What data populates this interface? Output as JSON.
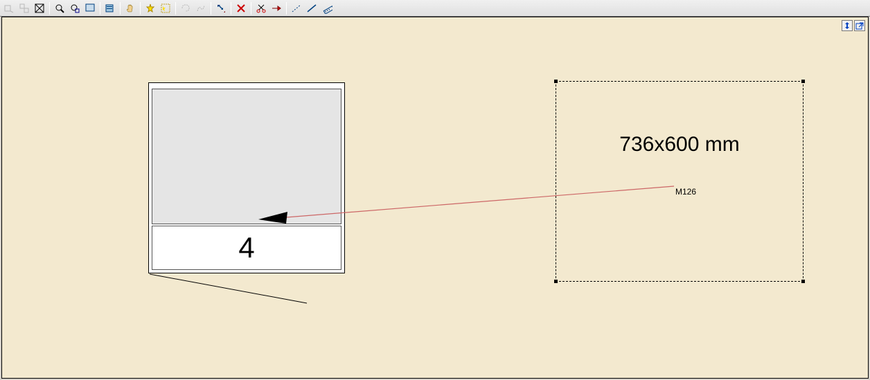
{
  "toolbar": {
    "groups": [
      [
        "zoom-window-icon",
        "zoom-out-icon",
        "zoom-fit-icon"
      ],
      [
        "zoom-in-tool-icon",
        "zoom-extents-icon",
        "zoom-selected-icon"
      ],
      [
        "properties-icon"
      ],
      [
        "pan-icon"
      ],
      [
        "new-star-icon",
        "select-area-icon"
      ],
      [
        "lasso-icon",
        "freehand-icon"
      ],
      [
        "move-arrow-icon"
      ],
      [
        "delete-icon"
      ],
      [
        "cut-icon",
        "arrow-right-red-icon"
      ],
      [
        "line-dash-icon",
        "line-solid-icon",
        "measure-icon"
      ]
    ]
  },
  "corner": {
    "btn1": "resize-vertical-icon",
    "btn2": "external-link-icon"
  },
  "leftShape": {
    "number": "4"
  },
  "rightShape": {
    "dimension": "736x600 mm",
    "marker": "M126"
  }
}
